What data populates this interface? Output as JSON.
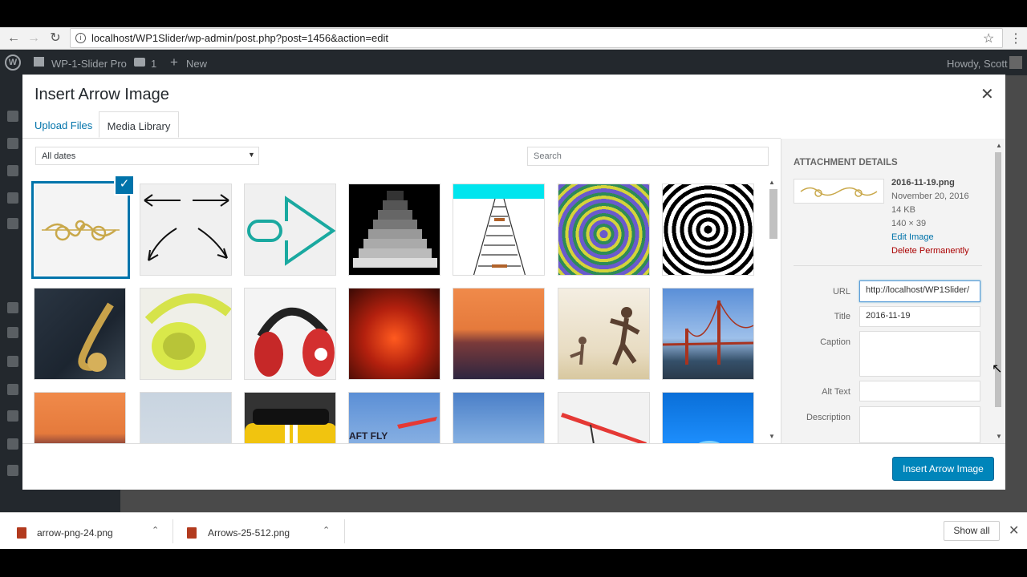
{
  "browser": {
    "url": "localhost/WP1Slider/wp-admin/post.php?post=1456&action=edit"
  },
  "wp_admin_bar": {
    "site_name": "WP-1-Slider Pro",
    "comments_count": "1",
    "new_label": "New",
    "howdy": "Howdy, Scott"
  },
  "modal": {
    "title": "Insert Arrow Image",
    "tabs": [
      "Upload Files",
      "Media Library"
    ],
    "date_filter": "All dates",
    "search_placeholder": "Search",
    "insert_button": "Insert Arrow Image"
  },
  "attachment": {
    "heading": "ATTACHMENT DETAILS",
    "filename": "2016-11-19.png",
    "date": "November 20, 2016",
    "size": "14 KB",
    "dimensions": "140 × 39",
    "edit_link": "Edit Image",
    "delete_link": "Delete Permanently",
    "fields": {
      "url_label": "URL",
      "url_value": "http://localhost/WP1Slider/",
      "title_label": "Title",
      "title_value": "2016-11-19",
      "caption_label": "Caption",
      "alt_label": "Alt Text",
      "description_label": "Description"
    }
  },
  "media_items": [
    {
      "kind": "ornament",
      "selected": true
    },
    {
      "kind": "arrows-sketch"
    },
    {
      "kind": "teal-arrow"
    },
    {
      "kind": "grey-steps"
    },
    {
      "kind": "rail-track"
    },
    {
      "kind": "psychedelic"
    },
    {
      "kind": "bw-spiral"
    },
    {
      "kind": "saxophone"
    },
    {
      "kind": "yellow-headphones"
    },
    {
      "kind": "red-headphones"
    },
    {
      "kind": "red-lights"
    },
    {
      "kind": "sunset-hills"
    },
    {
      "kind": "beach-kids"
    },
    {
      "kind": "golden-gate"
    },
    {
      "kind": "sunset-hills"
    },
    {
      "kind": "pale-sky"
    },
    {
      "kind": "yellow-car"
    },
    {
      "kind": "sky-plane"
    },
    {
      "kind": "sky-mountain"
    },
    {
      "kind": "glider"
    },
    {
      "kind": "blue-ocean"
    }
  ],
  "downloads": {
    "items": [
      {
        "name": "arrow-png-24.png"
      },
      {
        "name": "Arrows-25-512.png"
      }
    ],
    "show_all": "Show all"
  }
}
